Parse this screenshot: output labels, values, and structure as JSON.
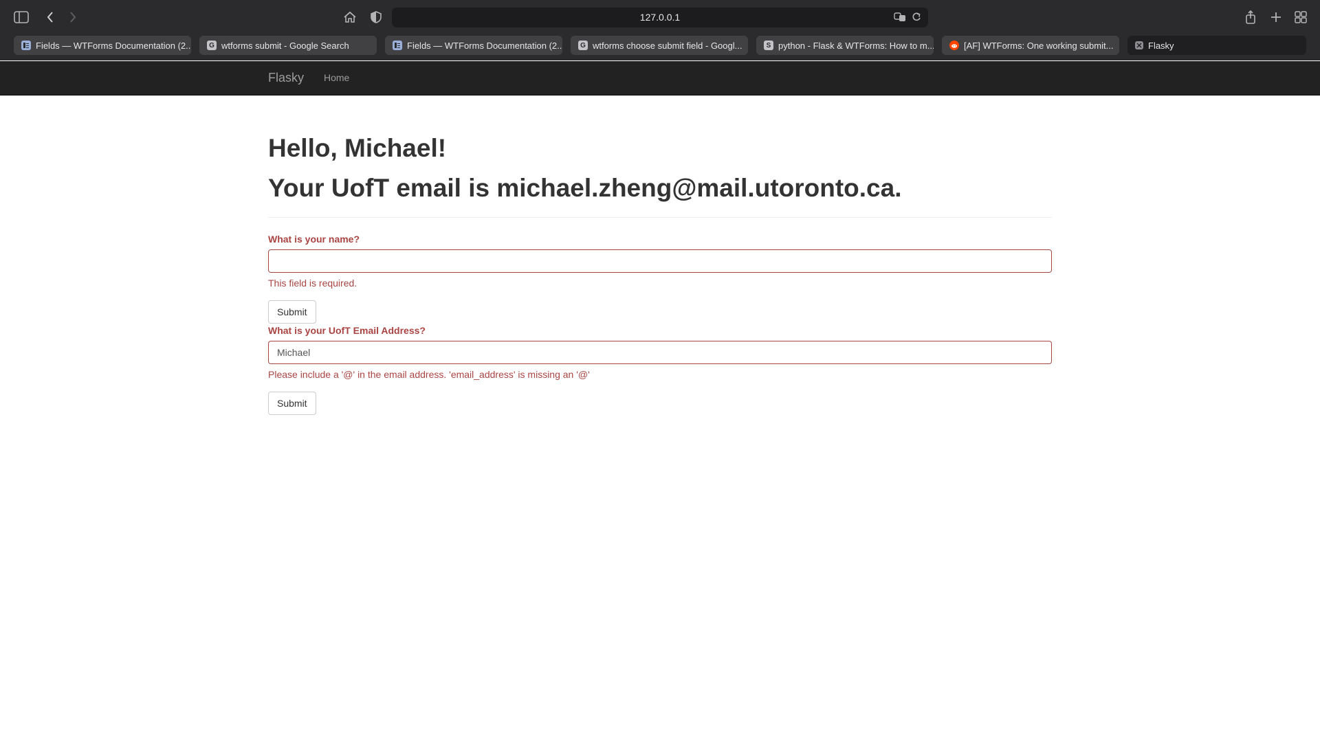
{
  "browser": {
    "url": "127.0.0.1",
    "tabs": [
      {
        "title": "Fields — WTForms Documentation (2...",
        "icon": "doc-icon",
        "active": false
      },
      {
        "title": "wtforms submit - Google Search",
        "icon": "google-icon",
        "active": false
      },
      {
        "title": "Fields — WTForms Documentation (2...",
        "icon": "doc-icon",
        "active": false
      },
      {
        "title": "wtforms choose submit field - Googl...",
        "icon": "google-icon",
        "active": false
      },
      {
        "title": "python - Flask & WTForms: How to m...",
        "icon": "stackoverflow-icon",
        "active": false
      },
      {
        "title": "[AF] WTForms: One working submit...",
        "icon": "reddit-icon",
        "active": false
      },
      {
        "title": "Flasky",
        "icon": "default-favicon-icon",
        "active": true
      }
    ],
    "favicon_letters": {
      "google": "G",
      "stackoverflow": "S"
    }
  },
  "navbar": {
    "brand": "Flasky",
    "links": [
      "Home"
    ]
  },
  "page": {
    "greeting": "Hello, Michael!",
    "email_line": "Your UofT email is michael.zheng@mail.utoronto.ca.",
    "form_name": {
      "label": "What is your name?",
      "value": "",
      "error": "This field is required.",
      "submit_label": "Submit"
    },
    "form_email": {
      "label": "What is your UofT Email Address?",
      "value": "Michael",
      "error": "Please include a '@' in the email address. 'email_address' is missing an '@'",
      "submit_label": "Submit"
    }
  },
  "colors": {
    "error": "#a94442",
    "navbar": "#222222",
    "chrome": "#2b2a2c"
  }
}
